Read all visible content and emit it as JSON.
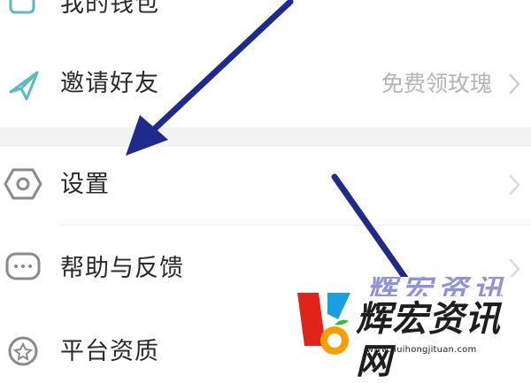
{
  "menu": {
    "items": [
      {
        "label": "我的钱包",
        "value": "",
        "icon": "wallet-icon"
      },
      {
        "label": "邀请好友",
        "value": "免费领玫瑰",
        "icon": "paper-plane-icon"
      },
      {
        "label": "设置",
        "value": "",
        "icon": "hexagon-gear-icon"
      },
      {
        "label": "帮助与反馈",
        "value": "",
        "icon": "chat-bubble-icon"
      },
      {
        "label": "平台资质",
        "value": "",
        "icon": "badge-icon"
      }
    ]
  },
  "watermark": {
    "name": "辉宏资讯网",
    "faded_name": "辉宏资讯网",
    "url": "www.huihongjituan.com"
  },
  "colors": {
    "arrow": "#1e2a8c",
    "icon": "#5bb8c5",
    "logo_red": "#e0241b",
    "logo_blue": "#1aa0e0",
    "logo_orange": "#f5a000",
    "logo_green": "#3cb83c"
  }
}
